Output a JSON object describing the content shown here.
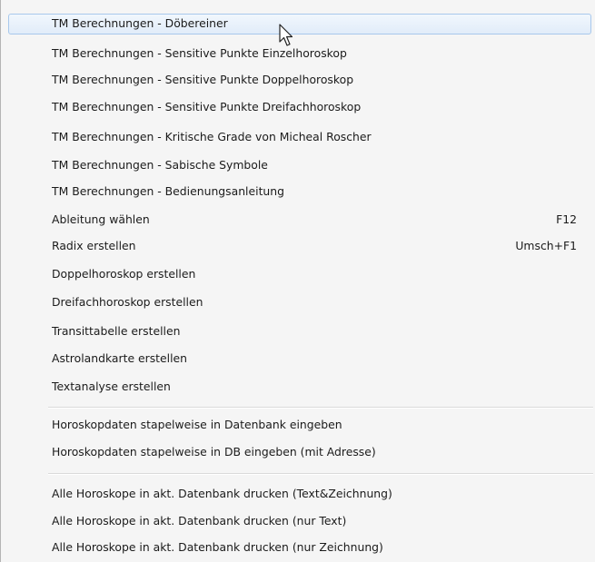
{
  "menu": {
    "items": [
      {
        "label": "TM Berechnungen - Döbereiner",
        "shortcut": ""
      },
      {
        "label": "TM Berechnungen - Sensitive Punkte Einzelhoroskop",
        "shortcut": ""
      },
      {
        "label": "TM Berechnungen - Sensitive Punkte Doppelhoroskop",
        "shortcut": ""
      },
      {
        "label": "TM Berechnungen - Sensitive Punkte Dreifachhoroskop",
        "shortcut": ""
      },
      {
        "label": "TM Berechnungen - Kritische Grade von Micheal Roscher",
        "shortcut": ""
      },
      {
        "label": "TM Berechnungen - Sabische Symbole",
        "shortcut": ""
      },
      {
        "label": "TM Berechnungen - Bedienungsanleitung",
        "shortcut": ""
      },
      {
        "label": "Ableitung wählen",
        "shortcut": "F12"
      },
      {
        "label": "Radix erstellen",
        "shortcut": "Umsch+F1"
      },
      {
        "label": "Doppelhoroskop erstellen",
        "shortcut": ""
      },
      {
        "label": "Dreifachhoroskop erstellen",
        "shortcut": ""
      },
      {
        "label": "Transittabelle erstellen",
        "shortcut": ""
      },
      {
        "label": "Astrolandkarte erstellen",
        "shortcut": ""
      },
      {
        "label": "Textanalyse erstellen",
        "shortcut": ""
      },
      {
        "label": "Horoskopdaten stapelweise in Datenbank eingeben",
        "shortcut": ""
      },
      {
        "label": "Horoskopdaten stapelweise in DB eingeben (mit Adresse)",
        "shortcut": ""
      },
      {
        "label": "Alle Horoskope in akt. Datenbank drucken (Text&Zeichnung)",
        "shortcut": ""
      },
      {
        "label": "Alle Horoskope in akt. Datenbank drucken (nur Text)",
        "shortcut": ""
      },
      {
        "label": "Alle Horoskope in akt. Datenbank drucken (nur Zeichnung)",
        "shortcut": ""
      }
    ],
    "hover_color": "#e1ecf9"
  }
}
